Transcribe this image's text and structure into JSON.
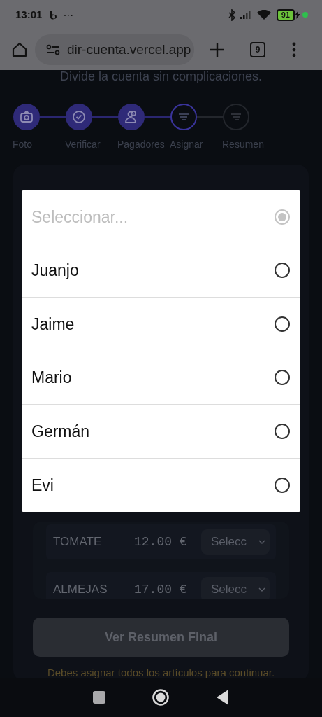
{
  "status_bar": {
    "time": "13:01",
    "more": "···",
    "battery": "91"
  },
  "browser": {
    "url": "dir-cuenta.vercel.app",
    "tab_count": "9"
  },
  "subtitle": "Divide la cuenta sin complicaciones.",
  "steps": [
    {
      "label": "Foto",
      "completed": true,
      "selected": false
    },
    {
      "label": "Verificar",
      "completed": true,
      "selected": false
    },
    {
      "label": "Pagadores",
      "completed": true,
      "selected": false
    },
    {
      "label": "Asignar",
      "completed": false,
      "selected": true
    },
    {
      "label": "Resumen",
      "completed": false,
      "selected": false
    }
  ],
  "card": {
    "items": [
      {
        "name": "TOMATE",
        "price": "12.00 €",
        "select": "Selecc"
      },
      {
        "name": "ALMEJAS",
        "price": "17.00 €",
        "select": "Selecc"
      }
    ],
    "button": {
      "label": "Ver Resumen Final",
      "disabled": true
    },
    "warning": "Debes asignar todos los artículos para continuar."
  },
  "dialog": {
    "options": [
      {
        "label": "Seleccionar...",
        "selected": true,
        "disabled": true
      },
      {
        "label": "Juanjo",
        "selected": false,
        "disabled": false
      },
      {
        "label": "Jaime",
        "selected": false,
        "disabled": false
      },
      {
        "label": "Mario",
        "selected": false,
        "disabled": false
      },
      {
        "label": "Germán",
        "selected": false,
        "disabled": false
      },
      {
        "label": "Evi",
        "selected": false,
        "disabled": false
      }
    ]
  }
}
